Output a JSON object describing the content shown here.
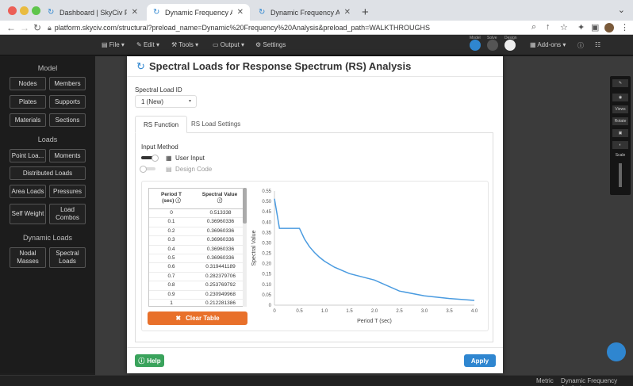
{
  "browser": {
    "tabs": [
      {
        "label": "Dashboard | SkyCiv Platform"
      },
      {
        "label": "Dynamic Frequency Analysis |"
      },
      {
        "label": "Dynamic Frequency Analysis |"
      }
    ],
    "url": "platform.skyciv.com/structural?preload_name=Dynamic%20Frequency%20Analysis&preload_path=WALKTHROUGHS"
  },
  "toolbar": {
    "file": "File",
    "edit": "Edit",
    "tools": "Tools",
    "output": "Output",
    "settings": "Settings",
    "addons": "Add-ons",
    "model_caption": "Model",
    "solve_caption": "Solve",
    "design_caption": "Design"
  },
  "left_panel": {
    "model_title": "Model",
    "loads_title": "Loads",
    "dynamic_title": "Dynamic Loads",
    "model_buttons": [
      "Nodes",
      "Members",
      "Plates",
      "Supports",
      "Materials",
      "Sections"
    ],
    "load_buttons": [
      "Point Loa...",
      "Moments",
      "Distributed Loads",
      "Area Loads",
      "Pressures",
      "Self Weight",
      "Load Combos"
    ],
    "dynamic_buttons": [
      "Nodal Masses",
      "Spectral Loads"
    ]
  },
  "right_toolbar": {
    "views": "Views",
    "rotate": "Rotate",
    "scale": "Scale"
  },
  "status_bar": {
    "metric": "Metric",
    "project": "Dynamic Frequency Analysis"
  },
  "modal": {
    "title": "Spectral Loads for Response Spectrum (RS) Analysis",
    "spectral_load_id_label": "Spectral Load ID",
    "spectral_load_id_value": "1 (New)",
    "tabs": [
      "RS Function",
      "RS Load Settings"
    ],
    "input_method_label": "Input Method",
    "option_user_input": "User Input",
    "option_design_code": "Design Code",
    "table": {
      "headers": [
        "Period T (sec)",
        "Spectral Value"
      ],
      "rows": [
        [
          "0",
          "0.513338"
        ],
        [
          "0.1",
          "0.36960336"
        ],
        [
          "0.2",
          "0.36960336"
        ],
        [
          "0.3",
          "0.36960336"
        ],
        [
          "0.4",
          "0.36960336"
        ],
        [
          "0.5",
          "0.36960336"
        ],
        [
          "0.6",
          "0.319441189"
        ],
        [
          "0.7",
          "0.282379706"
        ],
        [
          "0.8",
          "0.253769792"
        ],
        [
          "0.9",
          "0.230949968"
        ],
        [
          "1",
          "0.212281386"
        ]
      ]
    },
    "clear_table": "Clear Table",
    "help": "Help",
    "apply": "Apply"
  },
  "colors": {
    "accent": "#2f86d0",
    "clear": "#e8702a",
    "help": "#3aa35c",
    "line": "#4a9be0"
  },
  "chart_data": {
    "type": "line",
    "xlabel": "Period T (sec)",
    "ylabel": "Spectral Value",
    "xlim": [
      0,
      4.0
    ],
    "ylim": [
      0,
      0.55
    ],
    "xticks": [
      "0",
      "0.5",
      "1.0",
      "1.5",
      "2.0",
      "2.5",
      "3.0",
      "3.5",
      "4.0"
    ],
    "yticks": [
      "0",
      "0.05",
      "0.10",
      "0.15",
      "0.20",
      "0.25",
      "0.30",
      "0.35",
      "0.40",
      "0.45",
      "0.50",
      "0.55"
    ],
    "grid": false,
    "series": [
      {
        "x": [
          0,
          0.1,
          0.2,
          0.3,
          0.4,
          0.5,
          0.6,
          0.7,
          0.8,
          0.9,
          1.0,
          1.2,
          1.5,
          2.0,
          2.5,
          3.0,
          3.5,
          4.0
        ],
        "values": [
          0.513,
          0.37,
          0.37,
          0.37,
          0.37,
          0.37,
          0.319,
          0.282,
          0.254,
          0.231,
          0.212,
          0.183,
          0.152,
          0.121,
          0.068,
          0.045,
          0.032,
          0.023
        ]
      }
    ]
  }
}
